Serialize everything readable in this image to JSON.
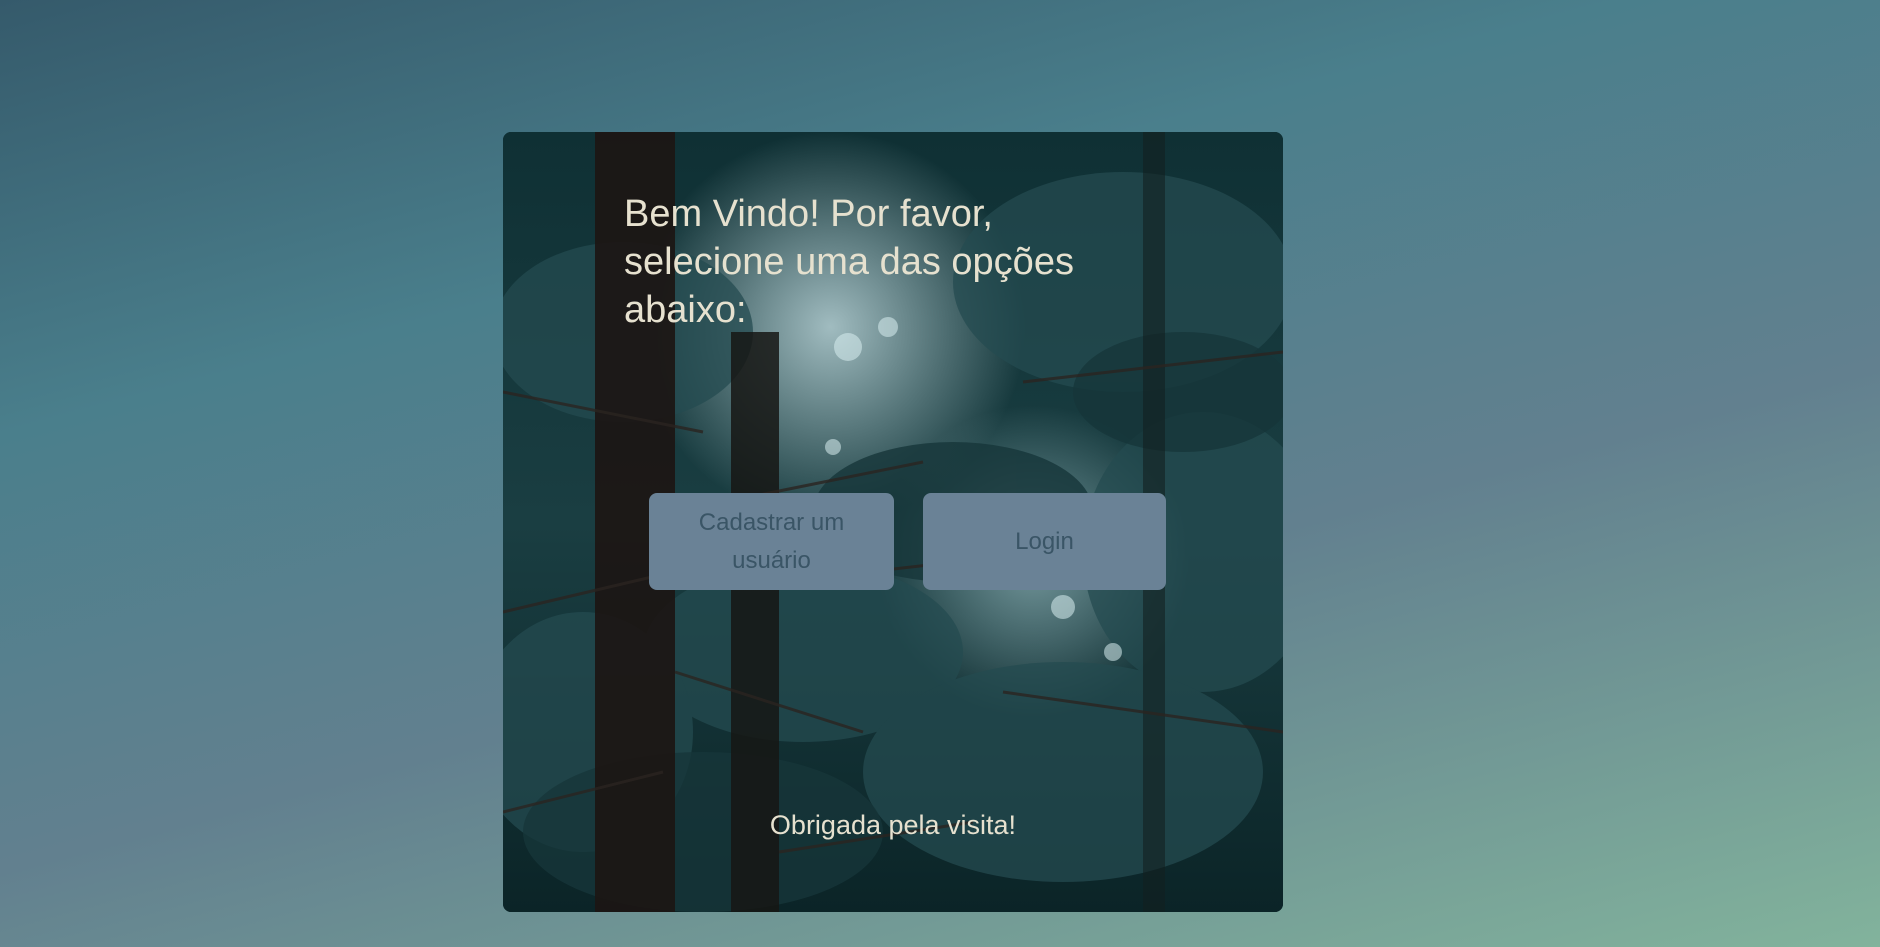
{
  "welcome": {
    "heading": "Bem Vindo! Por favor, selecione uma das opções abaixo:"
  },
  "actions": {
    "register_label": "Cadastrar um usuário",
    "login_label": "Login"
  },
  "footer": {
    "thanks": "Obrigada pela visita!"
  },
  "colors": {
    "button_bg": "#6a8296",
    "button_text": "#3a5566",
    "heading_text": "#e6e1cf"
  }
}
